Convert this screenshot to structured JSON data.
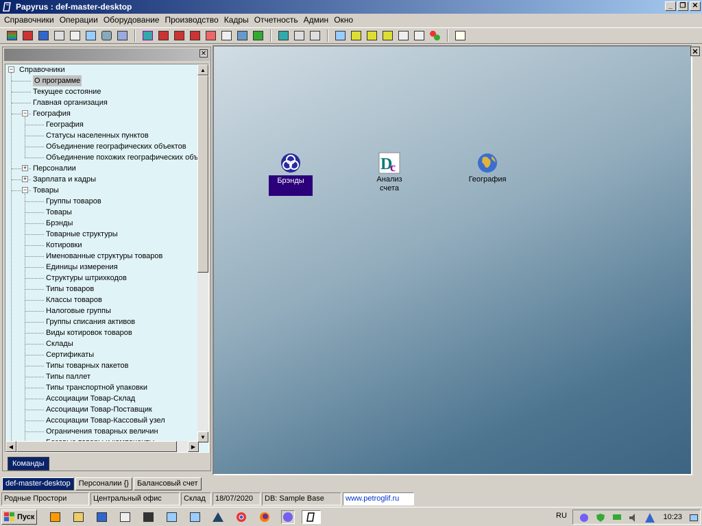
{
  "window": {
    "title": "Papyrus : def-master-desktop"
  },
  "menu": [
    "Справочники",
    "Операции",
    "Оборудование",
    "Производство",
    "Кадры",
    "Отчетность",
    "Админ",
    "Окно"
  ],
  "tree": {
    "root": "Справочники",
    "items": [
      {
        "label": "О программе",
        "level": 1,
        "selected": true
      },
      {
        "label": "Текущее состояние",
        "level": 1
      },
      {
        "label": "Главная организация",
        "level": 1
      },
      {
        "label": "География",
        "level": 1,
        "expander": "−"
      },
      {
        "label": "География",
        "level": 2
      },
      {
        "label": "Статусы населенных пунктов",
        "level": 2
      },
      {
        "label": "Объединение географических объектов",
        "level": 2
      },
      {
        "label": "Объединение похожих географических объ",
        "level": 2
      },
      {
        "label": "Персоналии",
        "level": 1,
        "expander": "+"
      },
      {
        "label": "Зарплата и кадры",
        "level": 1,
        "expander": "+"
      },
      {
        "label": "Товары",
        "level": 1,
        "expander": "−"
      },
      {
        "label": "Группы товаров",
        "level": 2
      },
      {
        "label": "Товары",
        "level": 2
      },
      {
        "label": "Брэнды",
        "level": 2
      },
      {
        "label": "Товарные структуры",
        "level": 2
      },
      {
        "label": "Котировки",
        "level": 2
      },
      {
        "label": "Именованные структуры товаров",
        "level": 2
      },
      {
        "label": "Единицы измерения",
        "level": 2
      },
      {
        "label": "Структуры штрихкодов",
        "level": 2
      },
      {
        "label": "Типы товаров",
        "level": 2
      },
      {
        "label": "Классы товаров",
        "level": 2
      },
      {
        "label": "Налоговые группы",
        "level": 2
      },
      {
        "label": "Группы списания активов",
        "level": 2
      },
      {
        "label": "Виды котировок товаров",
        "level": 2
      },
      {
        "label": "Склады",
        "level": 2
      },
      {
        "label": "Сертификаты",
        "level": 2
      },
      {
        "label": "Типы товарных пакетов",
        "level": 2
      },
      {
        "label": "Типы паллет",
        "level": 2
      },
      {
        "label": "Типы транспортной упаковки",
        "level": 2
      },
      {
        "label": "Ассоциации Товар-Склад",
        "level": 2
      },
      {
        "label": "Ассоциации Товар-Поставщик",
        "level": 2
      },
      {
        "label": "Ассоциации Товар-Кассовый узел",
        "level": 2
      },
      {
        "label": "Ограничения товарных величин",
        "level": 2
      },
      {
        "label": "Базовые товары и компоненты",
        "level": 2
      }
    ]
  },
  "commands_tab": "Команды",
  "desktop_icons": [
    {
      "label": "Брэнды",
      "selected": true
    },
    {
      "label": "Анализ счета"
    },
    {
      "label": "География"
    }
  ],
  "window_tabs": [
    "def-master-desktop",
    "Персоналии {}",
    "Балансовый счет"
  ],
  "status": {
    "company": "Родные Простори",
    "office": "Центральный офис",
    "warehouse": "Склад",
    "date": "18/07/2020",
    "db": "DB: Sample Base",
    "site": "www.petroglif.ru"
  },
  "taskbar": {
    "start": "Пуск",
    "lang": "RU",
    "clock": "10:23"
  },
  "colors": {
    "titlebar": "#0a246a",
    "tree_bg": "#e0f3f6",
    "selected_label": "#2b007a"
  }
}
